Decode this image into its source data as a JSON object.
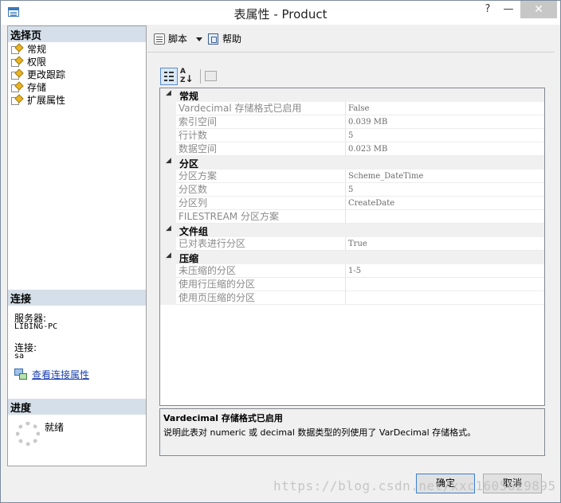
{
  "window": {
    "title": "表属性 - Product",
    "help_btn": "?",
    "min_btn": "—",
    "close_btn": "✕"
  },
  "left_panel": {
    "select_page_header": "选择页",
    "nav_items": [
      {
        "label": "常规"
      },
      {
        "label": "权限"
      },
      {
        "label": "更改跟踪"
      },
      {
        "label": "存储"
      },
      {
        "label": "扩展属性"
      }
    ],
    "connection_header": "连接",
    "server_label": "服务器:",
    "server_value": "LIBING-PC",
    "connection_label": "连接:",
    "connection_value": "sa",
    "view_connection_link": "查看连接属性",
    "progress_header": "进度",
    "progress_status": "就绪"
  },
  "toolbar": {
    "script_label": "脚本",
    "help_label": "帮助"
  },
  "property_grid": {
    "sort_buttons": {
      "az_label": "A Z"
    },
    "categories": [
      {
        "name": "常规",
        "properties": [
          {
            "name": "Vardecimal 存储格式已启用",
            "value": "False"
          },
          {
            "name": "索引空间",
            "value": "0.039 MB"
          },
          {
            "name": "行计数",
            "value": "5"
          },
          {
            "name": "数据空间",
            "value": "0.023 MB"
          }
        ]
      },
      {
        "name": "分区",
        "properties": [
          {
            "name": "分区方案",
            "value": "Scheme_DateTime"
          },
          {
            "name": "分区数",
            "value": "5"
          },
          {
            "name": "分区列",
            "value": "CreateDate"
          },
          {
            "name": "FILESTREAM 分区方案",
            "value": ""
          }
        ]
      },
      {
        "name": "文件组",
        "properties": [
          {
            "name": "已对表进行分区",
            "value": "True"
          }
        ]
      },
      {
        "name": "压缩",
        "properties": [
          {
            "name": "未压缩的分区",
            "value": "1-5"
          },
          {
            "name": "使用行压缩的分区",
            "value": ""
          },
          {
            "name": "使用页压缩的分区",
            "value": ""
          }
        ]
      }
    ]
  },
  "description": {
    "title": "Vardecimal 存储格式已启用",
    "text": "说明此表对 numeric 或 decimal 数据类型的列使用了 VarDecimal 存储格式。"
  },
  "footer": {
    "ok_label": "确定",
    "cancel_label": "取消"
  },
  "watermark": "https://blog.csdn.net/xxc1605629895"
}
